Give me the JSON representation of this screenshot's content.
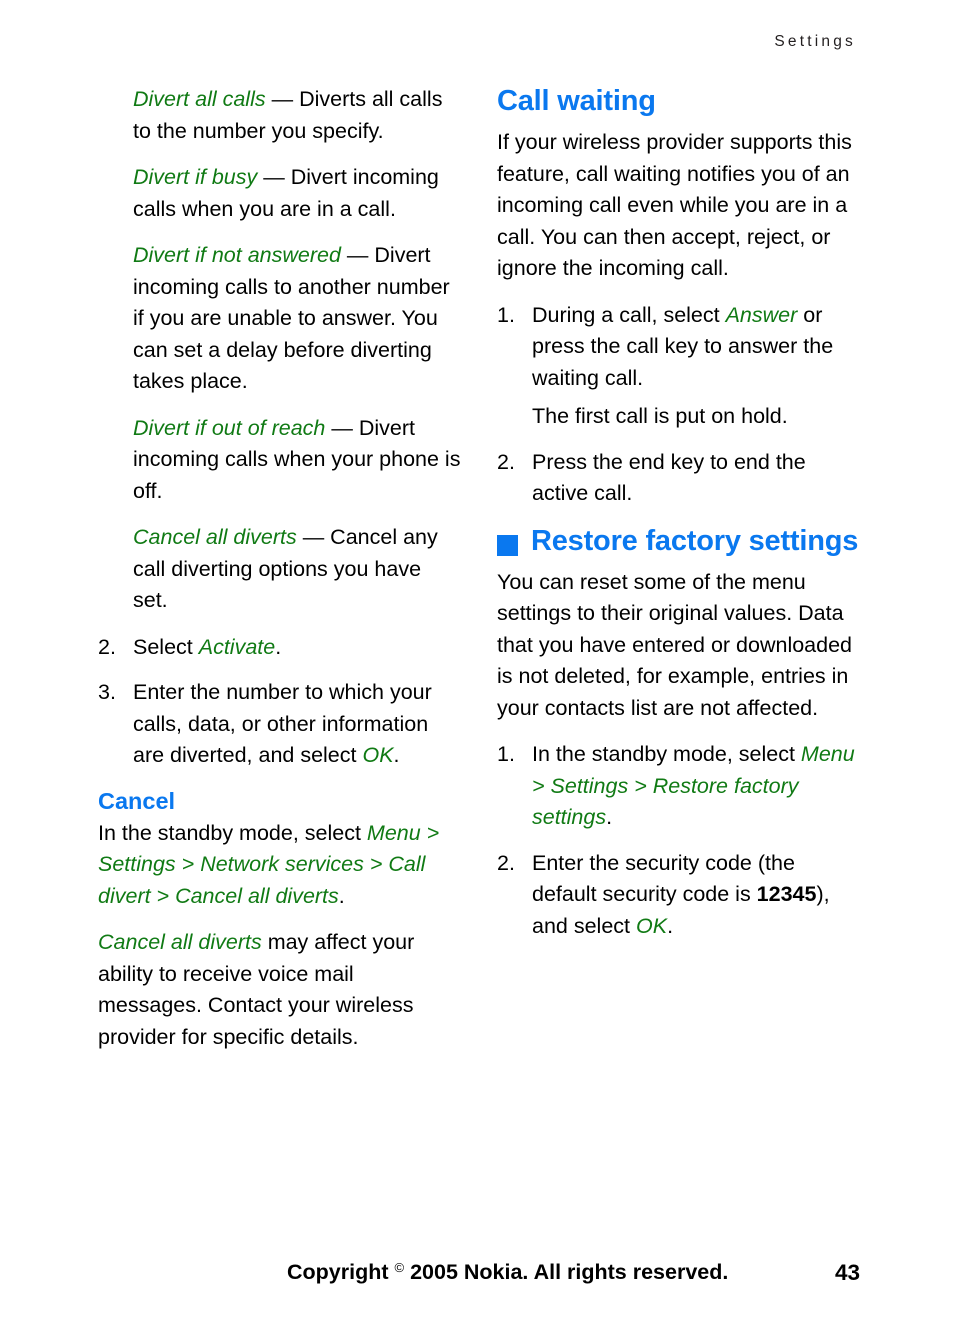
{
  "header": {
    "running_title": "Settings"
  },
  "left_column": {
    "definitions": [
      {
        "term": "Divert all calls",
        "dash": " — ",
        "description": "Diverts all calls to the number you specify."
      },
      {
        "term": "Divert if busy",
        "dash": " — ",
        "description": "Divert incoming calls when you are in a call."
      },
      {
        "term": "Divert if not answered",
        "dash": " — ",
        "description": "Divert incoming calls to another number if you are unable to answer. You can set a delay before diverting takes place."
      },
      {
        "term": "Divert if out of reach",
        "dash": " — ",
        "description": "Divert incoming calls when your phone is off."
      },
      {
        "term": "Cancel all diverts",
        "dash": " — ",
        "description": "Cancel any call diverting options you have set."
      }
    ],
    "steps": [
      {
        "number": "2.",
        "pre": "Select ",
        "emph": "Activate",
        "post": "."
      },
      {
        "number": "3.",
        "pre": "Enter the number to which your calls, data, or other information are diverted, and select ",
        "emph": "OK",
        "post": "."
      }
    ],
    "cancel_section": {
      "heading": "Cancel",
      "path_intro": "In the standby mode, select ",
      "path": "Menu > Settings > Network services > Call divert > Cancel all diverts",
      "path_end": ".",
      "note_emph": "Cancel all diverts",
      "note_rest": " may affect your ability to receive voice mail messages. Contact your wireless provider for specific details."
    }
  },
  "right_column": {
    "call_waiting": {
      "heading": "Call waiting",
      "intro": "If your wireless provider supports this feature, call waiting notifies you of an incoming call even while you are in a call. You can then accept, reject, or ignore the incoming call.",
      "steps": [
        {
          "number": "1.",
          "pre": "During a call, select ",
          "emph": "Answer",
          "post": " or press the call key to answer the waiting call."
        }
      ],
      "continuation": "The first call is put on hold.",
      "steps2": [
        {
          "number": "2.",
          "pre": "Press the end key to end the active call.",
          "emph": "",
          "post": ""
        }
      ]
    },
    "restore": {
      "heading": "Restore factory settings",
      "intro": "You can reset some of the menu settings to their original values. Data that you have entered or downloaded is not deleted, for example, entries in your contacts list are not affected.",
      "step1": {
        "number": "1.",
        "pre": "In the standby mode, select ",
        "emph": "Menu > Settings > Restore factory settings",
        "post": "."
      },
      "step2": {
        "number": "2.",
        "pre": "Enter the security code (the default security code is ",
        "bold": "12345",
        "mid": "), and select ",
        "emph": "OK",
        "post": "."
      }
    }
  },
  "footer": {
    "copyright_pre": "Copyright ",
    "copyright_symbol": "©",
    "copyright_post": " 2005 Nokia. All rights reserved.",
    "page_number": "43"
  },
  "colors": {
    "heading_blue": "#0a78ef",
    "emphasis_green": "#107a14",
    "body_black": "#000000",
    "page_background": "#ffffff"
  }
}
